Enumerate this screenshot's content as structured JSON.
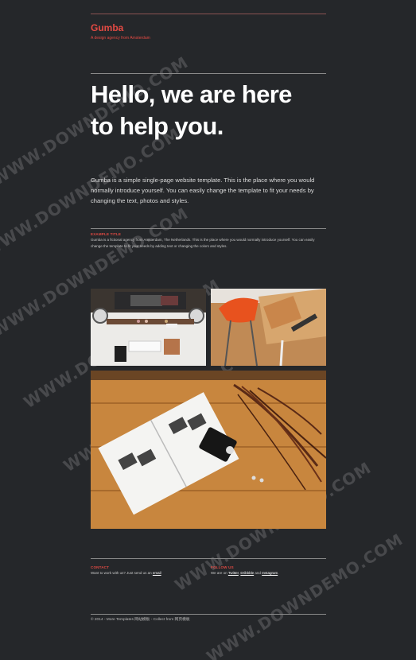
{
  "brand": {
    "name": "Gumba",
    "tagline": "A design agency from Amsterdam"
  },
  "hero": {
    "line1": "Hello, we are here",
    "line2": "to help you."
  },
  "intro": "Gumba is a simple single-page website template. This is the place where you would normally introduce yourself. You can easily change the template to fit your needs by changing the text, photos and styles.",
  "example": {
    "title": "EXAMPLE TITLE",
    "text": "Gumba is a fictional agency from Amsterdam, The Netherlands. This is the place where you would normally introduce yourself. You can easily change the template to fit your needs by adding text or changing the colors and styles."
  },
  "footer": {
    "contact_title": "CONTACT",
    "contact_text": "Want to work with us? Just send us an",
    "contact_link": "email",
    "follow_title": "FOLLOW US",
    "follow_text": "We are on",
    "follow_links": [
      "Twitter",
      "Dribbble",
      "Instagram"
    ],
    "follow_and": "and",
    "copyright": "© 2014 - More Templates 网站模板 - Collect from 网页模板"
  },
  "watermark": "WWW.DOWNDEMO.COM",
  "colors": {
    "background": "#25272a",
    "accent": "#e34a43",
    "heading": "#ffffff"
  }
}
